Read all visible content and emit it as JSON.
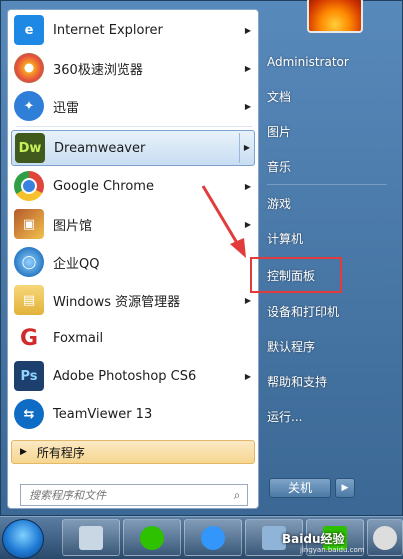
{
  "programs": [
    {
      "label": "Internet Explorer",
      "icon": "ie-icon",
      "color": "#1e88e5",
      "arrow": true
    },
    {
      "label": "360极速浏览器",
      "icon": "360-browser-icon",
      "color": "#f5a623",
      "arrow": true
    },
    {
      "label": "迅雷",
      "icon": "xunlei-icon",
      "color": "#2f7fd8",
      "arrow": true
    },
    {
      "label": "Dreamweaver",
      "icon": "dreamweaver-icon",
      "color": "#3f5a1c",
      "iconText": "Dw",
      "arrow": true,
      "highlighted": true
    },
    {
      "label": "Google Chrome",
      "icon": "chrome-icon",
      "color": "#e0463a",
      "arrow": true
    },
    {
      "label": "图片馆",
      "icon": "image-gallery-icon",
      "color": "#b55a2a",
      "arrow": true
    },
    {
      "label": "企业QQ",
      "icon": "qq-enterprise-icon",
      "color": "#2a7ac4",
      "arrow": false
    },
    {
      "label": "Windows 资源管理器",
      "icon": "explorer-icon",
      "color": "#e2b23a",
      "arrow": true
    },
    {
      "label": "Foxmail",
      "icon": "foxmail-icon",
      "color": "#d22a2a",
      "arrow": false
    },
    {
      "label": "Adobe Photoshop CS6",
      "icon": "photoshop-icon",
      "color": "#1c3f6e",
      "iconText": "Ps",
      "arrow": true
    },
    {
      "label": "TeamViewer 13",
      "icon": "teamviewer-icon",
      "color": "#0e6cc4",
      "arrow": false
    }
  ],
  "all_programs": "所有程序",
  "search": {
    "placeholder": "搜索程序和文件"
  },
  "right_menu": [
    {
      "label": "Administrator"
    },
    {
      "label": "文档"
    },
    {
      "label": "图片"
    },
    {
      "label": "音乐"
    },
    {
      "label": "游戏"
    },
    {
      "label": "计算机"
    },
    {
      "label": "控制面板",
      "highlighted": true
    },
    {
      "label": "设备和打印机"
    },
    {
      "label": "默认程序"
    },
    {
      "label": "帮助和支持"
    },
    {
      "label": "运行..."
    }
  ],
  "shutdown": {
    "label": "关机"
  },
  "watermark": {
    "brand": "Baidu经验",
    "url": "jingyan.baidu.com"
  },
  "colors": {
    "highlight_box": "#e23b3b",
    "annotation_arrow": "#e23b3b"
  }
}
